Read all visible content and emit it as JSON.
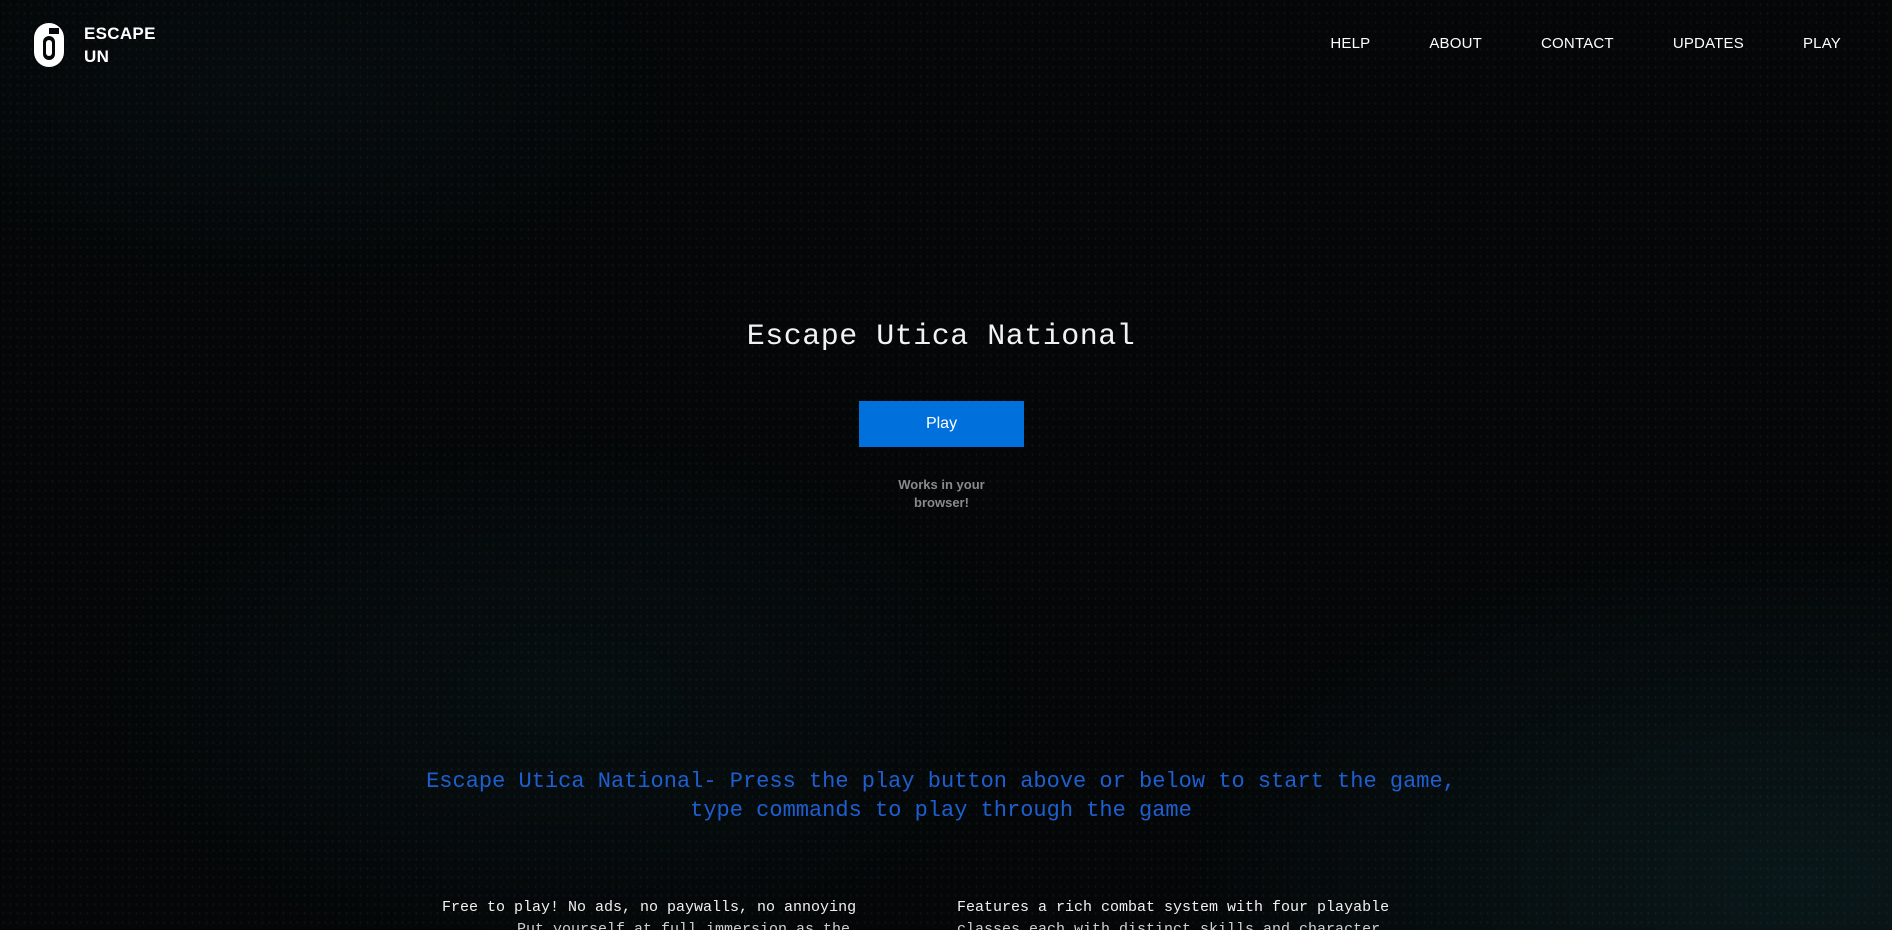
{
  "header": {
    "logo_text": "ESCAPE UN",
    "nav": [
      {
        "label": "HELP"
      },
      {
        "label": "ABOUT"
      },
      {
        "label": "CONTACT"
      },
      {
        "label": "UPDATES"
      },
      {
        "label": "PLAY"
      }
    ]
  },
  "hero": {
    "title": "Escape Utica National",
    "play_label": "Play",
    "note": "Works in your browser!"
  },
  "tagline": "Escape Utica National- Press the play button above or below to start the game, type commands to play through the game",
  "features": [
    {
      "line1": "Free to play! No ads, no paywalls, no annoying",
      "line2": "Put yourself at full immersion as the"
    },
    {
      "line1": "Features a rich combat system with four playable",
      "line2": "classes each with distinct skills and character"
    }
  ],
  "colors": {
    "accent": "#0070dd",
    "tagline": "#1e5fd0",
    "background": "#040607"
  }
}
